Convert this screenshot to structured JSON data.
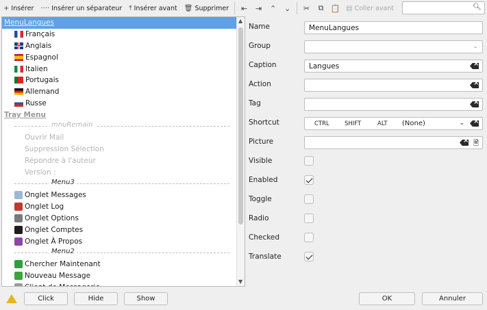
{
  "toolbar": {
    "insert": "Insérer",
    "insert_separator": "Insérer un séparateur",
    "insert_before": "Insérer avant",
    "delete": "Supprimer",
    "paste_before": "Coller avant",
    "search_value": ""
  },
  "tree": {
    "selected_label": "MenuLangues",
    "languages": [
      {
        "label": "Français",
        "flag": "fr"
      },
      {
        "label": "Anglais",
        "flag": "uk"
      },
      {
        "label": "Espagnol",
        "flag": "es"
      },
      {
        "label": "Italien",
        "flag": "it"
      },
      {
        "label": "Portugais",
        "flag": "pt"
      },
      {
        "label": "Allemand",
        "flag": "de"
      },
      {
        "label": "Russe",
        "flag": "ru"
      }
    ],
    "tray_menu": "Tray Menu",
    "sep_mnu_remain": "mnuRemain",
    "remain_items": [
      "Ouvrir Mail",
      "Suppression Sélection",
      "Répondre à l'auteur",
      "Version :"
    ],
    "sep_menu3": "Menu3",
    "menu3_items": [
      {
        "label": "Onglet Messages",
        "icon": "messages-icon",
        "color": "#9fb7d6"
      },
      {
        "label": "Onglet Log",
        "icon": "log-icon",
        "color": "#c0392b"
      },
      {
        "label": "Onglet Options",
        "icon": "options-icon",
        "color": "#7a7a7a"
      },
      {
        "label": "Onglet Comptes",
        "icon": "accounts-icon",
        "color": "#1d1d1d"
      },
      {
        "label": "Onglet À Propos",
        "icon": "about-icon",
        "color": "#8e44ad"
      }
    ],
    "sep_menu2": "Menu2",
    "menu2_items": [
      {
        "label": "Chercher Maintenant",
        "icon": "refresh-icon",
        "color": "#2e9e3f"
      },
      {
        "label": "Nouveau Message",
        "icon": "plus-icon",
        "color": "#3aa53a"
      },
      {
        "label": "Client de Messagerie",
        "icon": "mail-client-icon",
        "color": "#9a9a9a"
      }
    ]
  },
  "properties": {
    "name_label": "Name",
    "name_value": "MenuLangues",
    "group_label": "Group",
    "group_value": "",
    "caption_label": "Caption",
    "caption_value": "Langues",
    "action_label": "Action",
    "action_value": "",
    "tag_label": "Tag",
    "tag_value": "",
    "shortcut_label": "Shortcut",
    "shortcut_ctrl": "CTRL",
    "shortcut_shift": "SHIFT",
    "shortcut_alt": "ALT",
    "shortcut_key": "(None)",
    "picture_label": "Picture",
    "picture_value": "",
    "visible_label": "Visible",
    "visible": false,
    "enabled_label": "Enabled",
    "enabled": true,
    "toggle_label": "Toggle",
    "toggle": false,
    "radio_label": "Radio",
    "radio": false,
    "checked_label": "Checked",
    "checked": false,
    "translate_label": "Translate",
    "translate": true
  },
  "bottom": {
    "click": "Click",
    "hide": "Hide",
    "show": "Show",
    "ok": "OK",
    "cancel": "Annuler"
  },
  "colors": {
    "selection": "#5ea1e6",
    "warning": "#e6b422"
  }
}
